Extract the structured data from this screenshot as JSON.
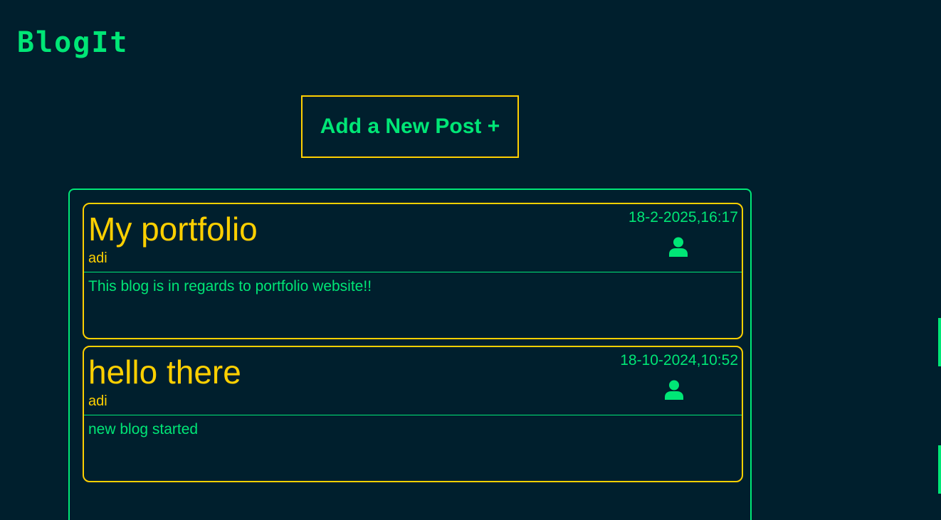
{
  "app": {
    "logo": "BlogIt",
    "add_post_label": "Add a New Post +",
    "accent_green": "#00e676",
    "accent_yellow": "#ffd000",
    "background": "#001f2d"
  },
  "posts": [
    {
      "title": "My portfolio",
      "author": "adi",
      "date": "18-2-2025,16:17",
      "body": "This blog is in regards to portfolio website!!",
      "icon": "user-icon"
    },
    {
      "title": "hello there",
      "author": "adi",
      "date": "18-10-2024,10:52",
      "body": "new blog started",
      "icon": "user-icon"
    }
  ]
}
